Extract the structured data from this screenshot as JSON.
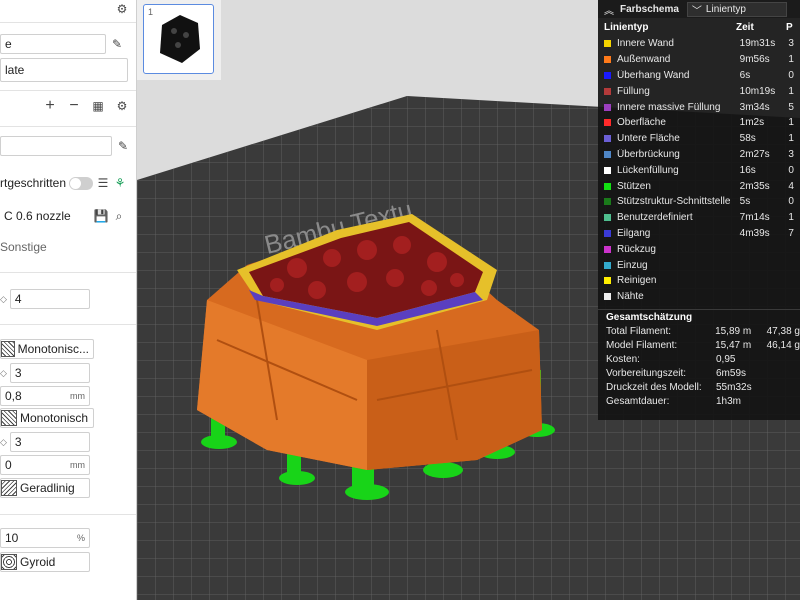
{
  "left_panel": {
    "plate_name_1": "e",
    "plate_name_2": "late",
    "process_field": "",
    "advanced_label": "rtgeschritten",
    "nozzle_label": "C 0.6 nozzle",
    "tab_other": "Sonstige",
    "wall_loops": "4",
    "top_pattern": "Monotonisc...",
    "top_layers": "3",
    "top_thickness": "0,8",
    "top_thickness_unit": "mm",
    "bottom_pattern": "Monotonisch",
    "bottom_layers": "3",
    "bottom_thickness": "0",
    "bottom_thickness_unit": "mm",
    "internal_pattern": "Geradlinig",
    "infill_density": "10",
    "infill_unit": "%",
    "infill_pattern": "Gyroid"
  },
  "thumbnail": {
    "index": "1"
  },
  "bed": {
    "logo_text": "Bambu Textu"
  },
  "legend": {
    "title": "Farbschema",
    "select_value": "Linientyp",
    "col_type": "Linientyp",
    "col_time": "Zeit",
    "col_pct": "P",
    "rows": [
      {
        "name": "Innere Wand",
        "time": "19m31s",
        "pct": "3",
        "color": "#f5d400"
      },
      {
        "name": "Außenwand",
        "time": "9m56s",
        "pct": "1",
        "color": "#ff7a1a"
      },
      {
        "name": "Überhang Wand",
        "time": "6s",
        "pct": "0",
        "color": "#1a1aff"
      },
      {
        "name": "Füllung",
        "time": "10m19s",
        "pct": "1",
        "color": "#b33a3a"
      },
      {
        "name": "Innere massive Füllung",
        "time": "3m34s",
        "pct": "5",
        "color": "#9b3fbf"
      },
      {
        "name": "Oberfläche",
        "time": "1m2s",
        "pct": "1",
        "color": "#ff2a2a"
      },
      {
        "name": "Untere Fläche",
        "time": "58s",
        "pct": "1",
        "color": "#6b5fd6"
      },
      {
        "name": "Überbrückung",
        "time": "2m27s",
        "pct": "3",
        "color": "#4f86c6"
      },
      {
        "name": "Lückenfüllung",
        "time": "16s",
        "pct": "0",
        "color": "#ffffff"
      },
      {
        "name": "Stützen",
        "time": "2m35s",
        "pct": "4",
        "color": "#12e012"
      },
      {
        "name": "Stützstruktur-Schnittstelle",
        "time": "5s",
        "pct": "0",
        "color": "#1a7a1a"
      },
      {
        "name": "Benutzerdefiniert",
        "time": "7m14s",
        "pct": "1",
        "color": "#4fbf8f"
      },
      {
        "name": "Eilgang",
        "time": "4m39s",
        "pct": "7",
        "color": "#3a3ad6"
      },
      {
        "name": "Rückzug",
        "time": "",
        "pct": "",
        "color": "#cc33cc"
      },
      {
        "name": "Einzug",
        "time": "",
        "pct": "",
        "color": "#33aacc"
      },
      {
        "name": "Reinigen",
        "time": "",
        "pct": "",
        "color": "#ffee00"
      },
      {
        "name": "Nähte",
        "time": "",
        "pct": "",
        "color": "#eeeeee"
      }
    ],
    "summary_title": "Gesamtschätzung",
    "summary": [
      {
        "label": "Total Filament:",
        "v1": "15,89 m",
        "v2": "47,38 g"
      },
      {
        "label": "Model Filament:",
        "v1": "15,47 m",
        "v2": "46,14 g"
      },
      {
        "label": "Kosten:",
        "v1": "0,95",
        "v2": ""
      },
      {
        "label": "Vorbereitungszeit:",
        "v1": "6m59s",
        "v2": ""
      },
      {
        "label": "Druckzeit des Modell:",
        "v1": "55m32s",
        "v2": ""
      },
      {
        "label": "Gesamtdauer:",
        "v1": "1h3m",
        "v2": ""
      }
    ]
  }
}
